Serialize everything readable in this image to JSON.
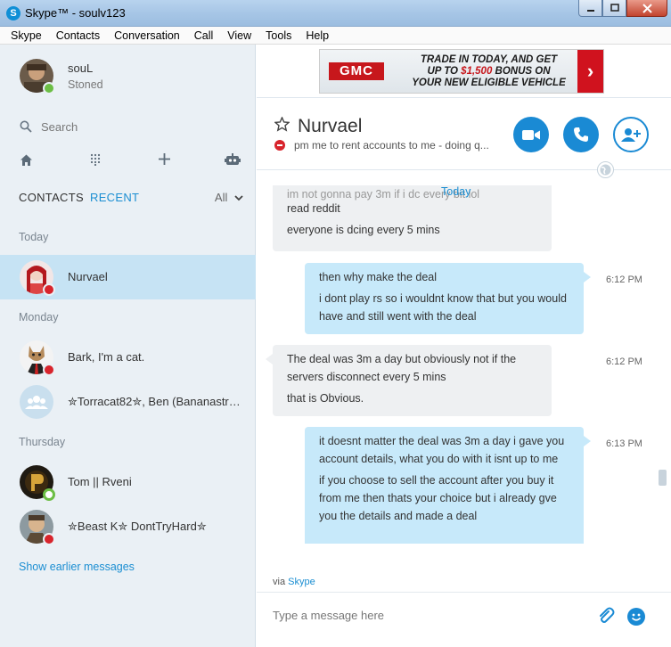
{
  "window": {
    "title": "Skype™ - soulv123",
    "app_icon": "S"
  },
  "menu": [
    "Skype",
    "Contacts",
    "Conversation",
    "Call",
    "View",
    "Tools",
    "Help"
  ],
  "profile": {
    "name": "souL",
    "mood": "Stoned",
    "status": "online"
  },
  "search": {
    "placeholder": "Search"
  },
  "nav_icons": [
    "home-icon",
    "dialpad-icon",
    "add-icon",
    "bot-icon"
  ],
  "tabs": {
    "contacts": "CONTACTS",
    "recent": "RECENT",
    "filter": "All"
  },
  "sections": {
    "today": "Today",
    "monday": "Monday",
    "thursday": "Thursday"
  },
  "contacts": [
    {
      "name": "Nurvael",
      "status": "busy",
      "selected": true
    },
    {
      "name": "Bark, I'm a cat.",
      "status": "busy"
    },
    {
      "name": "✮Torracat82✮, Ben (Bananastr…",
      "status": "group"
    },
    {
      "name": "Tom || Rveni",
      "status": "online"
    },
    {
      "name": "✮Beast K✮ DontTryHard✮",
      "status": "busy"
    }
  ],
  "show_earlier": "Show earlier messages",
  "ad": {
    "brand": "GMC",
    "line1": "TRADE IN TODAY, AND GET",
    "line2_pre": "UP TO ",
    "line2_amount": "$1,500",
    "line2_post": " BONUS ON",
    "line3": "YOUR NEW ELIGIBLE VEHICLE",
    "cta": "›"
  },
  "chat": {
    "title": "Nurvael",
    "mood": "pm me to rent accounts to me - doing q...",
    "date_label": "Today",
    "messages": [
      {
        "dir": "in",
        "lines": [
          "im not gonna pay 3m if i dc every bit lol",
          "read reddit",
          "everyone is dcing every 5 mins"
        ],
        "time": ""
      },
      {
        "dir": "out",
        "lines": [
          "then why make the deal",
          "i dont play rs so i wouldnt know that but you would have and still went with the deal"
        ],
        "time": "6:12 PM"
      },
      {
        "dir": "in",
        "lines": [
          "The deal was 3m a day but obviously not if the servers disconnect every 5 mins",
          "that is Obvious."
        ],
        "time": "6:12 PM"
      },
      {
        "dir": "out",
        "lines": [
          "it doesnt matter the deal was 3m a day i gave you account details, what you do with it isnt up to me",
          "if you choose to sell the account after you buy it from me then thats your choice but i already gve you the details and made a deal"
        ],
        "time": "6:13 PM"
      }
    ],
    "via_prefix": "via ",
    "via_link": "Skype",
    "compose_placeholder": "Type a message here"
  },
  "colors": {
    "accent": "#1a8ad4",
    "sidebar_bg": "#eaf0f5",
    "selected_bg": "#c6e3f4",
    "bubble_out": "#c7e9fa",
    "bubble_in": "#eef0f2",
    "busy": "#d8242c",
    "online": "#6cbe45"
  }
}
